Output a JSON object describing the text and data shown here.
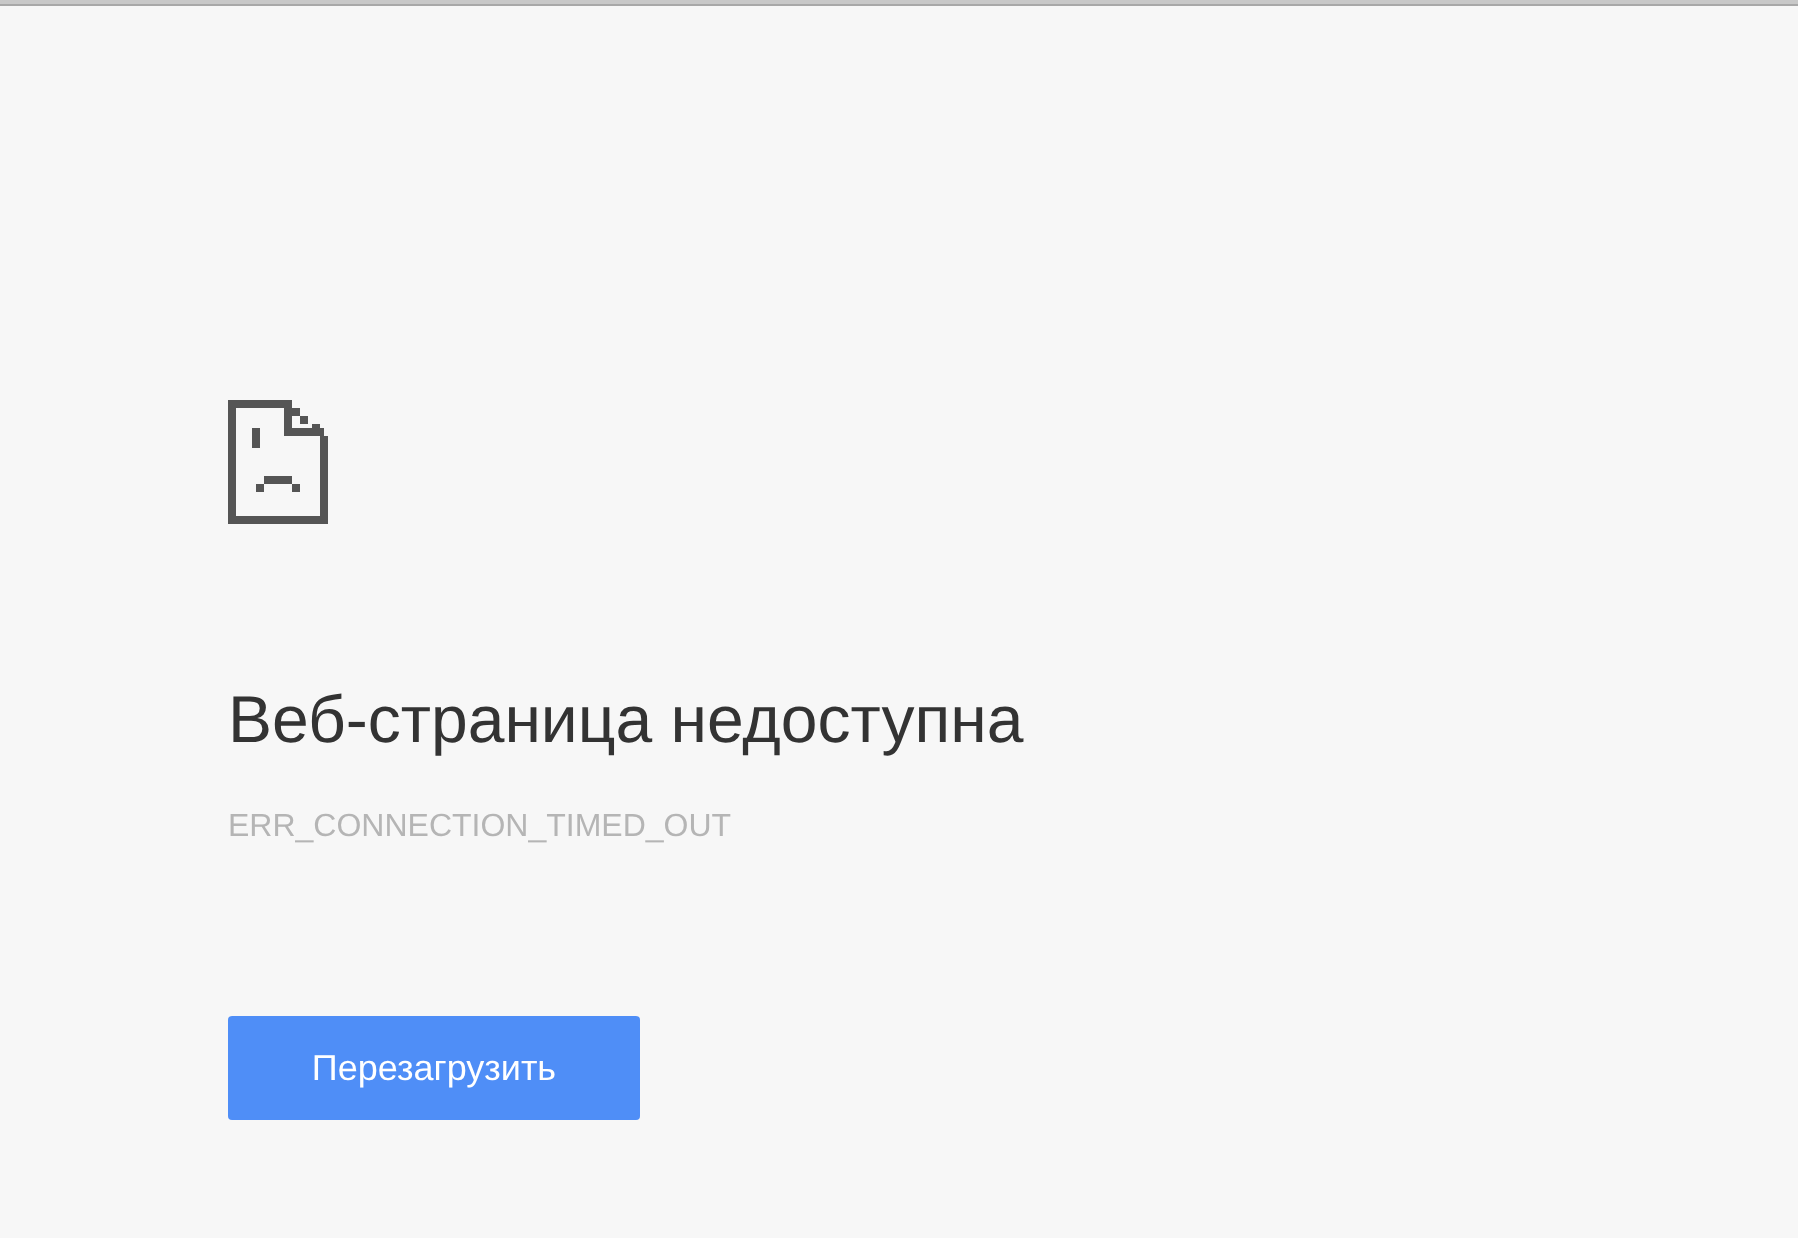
{
  "heading": "Веб-страница недоступна",
  "error_code": "ERR_CONNECTION_TIMED_OUT",
  "reload_button": "Перезагрузить"
}
